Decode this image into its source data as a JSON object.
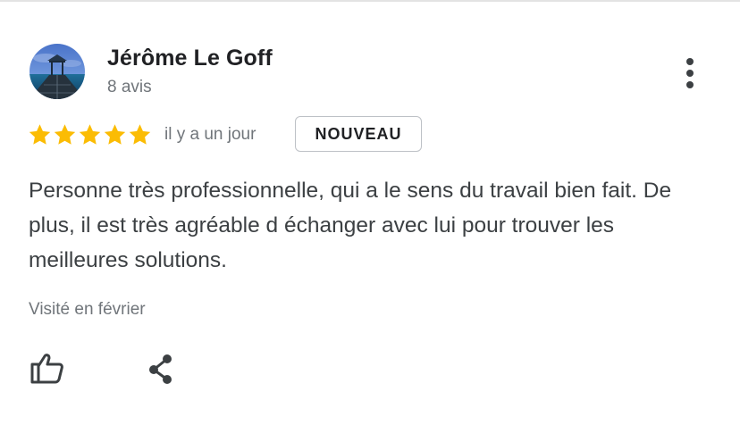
{
  "review": {
    "author_name": "Jérôme Le Goff",
    "review_count": "8 avis",
    "rating": 5,
    "rating_max": 5,
    "time_ago": "il y a un jour",
    "badge": "NOUVEAU",
    "text": "Personne très professionnelle, qui a le sens du travail bien fait. De plus, il est très agréable d échanger avec lui pour trouver les meilleures solutions.",
    "visit_date": "Visité en février"
  },
  "icons": {
    "avatar": "avatar-pier-photo",
    "more": "more-vert-icon",
    "star": "star-icon",
    "like": "thumb-up-icon",
    "share": "share-icon"
  },
  "colors": {
    "star": "#fbbc04",
    "text_primary": "#202124",
    "text_secondary": "#70757a",
    "body_text": "#3c4043",
    "badge_border": "#bdc1c6"
  }
}
